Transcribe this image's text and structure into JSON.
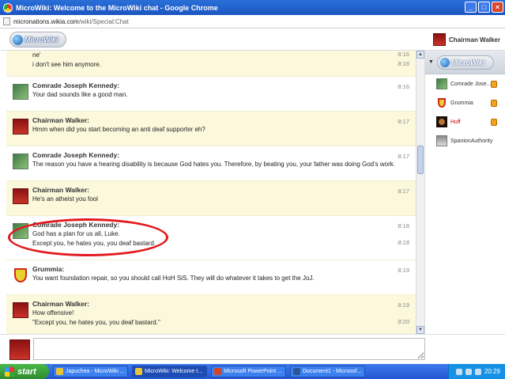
{
  "window": {
    "title": "MicroWiki: Welcome to the MicroWiki chat - Google Chrome",
    "buttons": {
      "minimize": "_",
      "maximize": "□",
      "close": "×"
    }
  },
  "address": {
    "host": "micronations.wikia.com",
    "path": "/wiki/Special:Chat"
  },
  "header": {
    "logo_text": "MicroWiki",
    "current_user": "Chairman Walker"
  },
  "messages": [
    {
      "type": "continuation",
      "lines": [
        "ne'",
        "i don't see him anymore."
      ],
      "times": [
        "8:16",
        "8:16"
      ],
      "highlight": true,
      "avatar": "none"
    },
    {
      "name": "Comrade Joseph Kennedy:",
      "lines": [
        "Your dad sounds like a good man."
      ],
      "times": [
        "8:16"
      ],
      "highlight": false,
      "avatar": "green"
    },
    {
      "name": "Chairman Walker:",
      "lines": [
        "Hmm when did you start becoming an anti deaf supporter eh?"
      ],
      "times": [
        "8:17"
      ],
      "highlight": true,
      "avatar": "red"
    },
    {
      "name": "Comrade Joseph Kennedy:",
      "lines": [
        "The reason you have a hearing disability is because God hates you. Therefore, by beating you, your father was doing God's work."
      ],
      "times": [
        "8:17"
      ],
      "highlight": false,
      "avatar": "green"
    },
    {
      "name": "Chairman Walker:",
      "lines": [
        "He's an atheist you fool"
      ],
      "times": [
        "8:17"
      ],
      "highlight": true,
      "avatar": "red"
    },
    {
      "name": "Comrade Joseph Kennedy:",
      "lines": [
        "God has a plan for us all, Luke.",
        "Except you, he hates you, you deaf bastard."
      ],
      "times": [
        "8:18",
        "8:18"
      ],
      "highlight": false,
      "avatar": "green"
    },
    {
      "name": "Grummia:",
      "lines": [
        "You want foundation repair, so you should call HoH SiS. They will do whatever it takes to get the JoJ."
      ],
      "times": [
        "8:19"
      ],
      "highlight": false,
      "avatar": "shield"
    },
    {
      "name": "Chairman Walker:",
      "lines": [
        "How offensive!",
        "\"Except you, he hates you, you deaf bastard.\""
      ],
      "times": [
        "8:19",
        "8:20"
      ],
      "highlight": true,
      "avatar": "red"
    }
  ],
  "userlist": {
    "logo_text": "MicroWiki",
    "users": [
      {
        "name": "Comrade Jose...",
        "avatar": "green",
        "badge": true,
        "color": "#333333"
      },
      {
        "name": "Grummia",
        "avatar": "shield",
        "badge": true,
        "color": "#333333"
      },
      {
        "name": "Huff",
        "avatar": "dark",
        "badge": true,
        "color": "#cc0000"
      },
      {
        "name": "SpanionAuthority",
        "avatar": "gray",
        "badge": false,
        "color": "#333333"
      }
    ]
  },
  "input": {
    "value": ""
  },
  "taskbar": {
    "start_label": "start",
    "tasks": [
      {
        "label": "Japuchea - MicroWiki ...",
        "active": false,
        "icon_color": "#e9c535"
      },
      {
        "label": "MicroWiki: Welcome t...",
        "active": true,
        "icon_color": "#e9c535"
      },
      {
        "label": "Microsoft PowerPoint ...",
        "active": false,
        "icon_color": "#d24726"
      },
      {
        "label": "Document1 - Microsof...",
        "active": false,
        "icon_color": "#2b5797"
      }
    ],
    "clock": "20:29"
  }
}
